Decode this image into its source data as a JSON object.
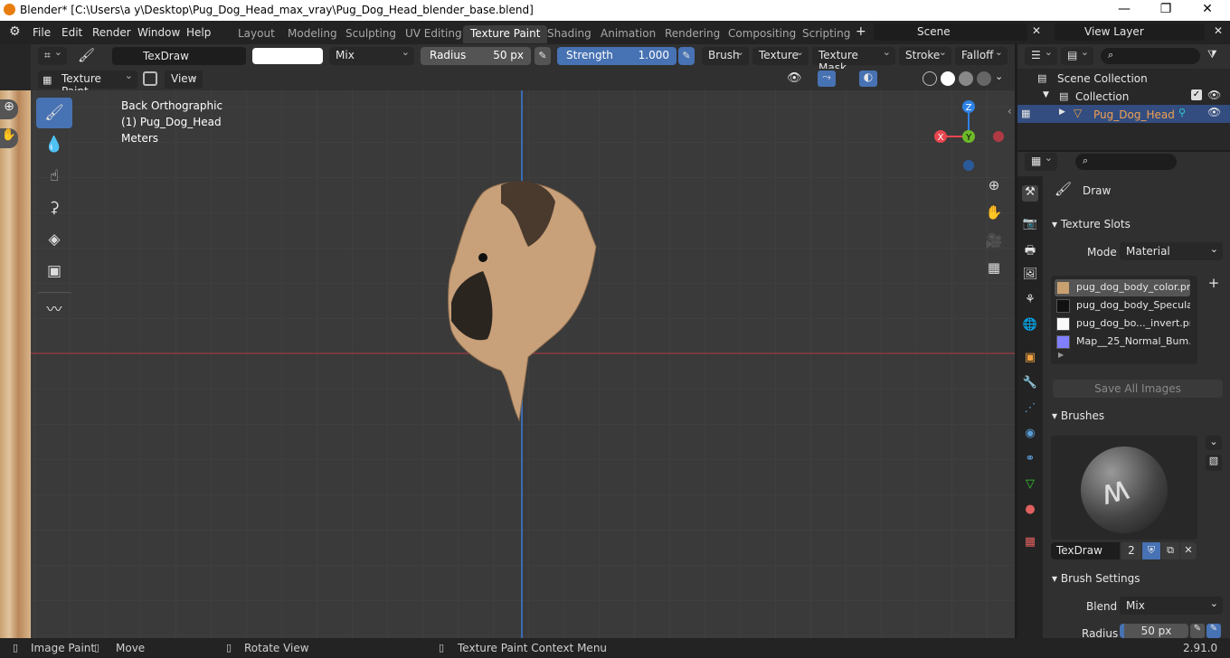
{
  "window": {
    "title": "Blender* [C:\\Users\\a y\\Desktop\\Pug_Dog_Head_max_vray\\Pug_Dog_Head_blender_base.blend]",
    "controls": [
      "—",
      "❐",
      "✕"
    ]
  },
  "menu": {
    "items": [
      "File",
      "Edit",
      "Render",
      "Window",
      "Help"
    ]
  },
  "workspaces": [
    "Layout",
    "Modeling",
    "Sculpting",
    "UV Editing",
    "Texture Paint",
    "Shading",
    "Animation",
    "Rendering",
    "Compositing",
    "Scripting"
  ],
  "scene": {
    "label": "Scene",
    "view_layer": "View Layer"
  },
  "tool_header": {
    "brush_name": "TexDraw",
    "blend": "Mix",
    "radius_label": "Radius",
    "radius_value": "50 px",
    "strength_label": "Strength",
    "strength_value": "1.000",
    "menus": [
      "Brush",
      "Texture",
      "Texture Mask",
      "Stroke",
      "Falloff"
    ]
  },
  "viewport_header": {
    "mode": "Texture Paint",
    "view": "View"
  },
  "viewport": {
    "line1": "Back Orthographic",
    "line2": "(1) Pug_Dog_Head",
    "line3": "Meters",
    "axes": {
      "x": "X",
      "y": "Y",
      "z": "Z"
    }
  },
  "outliner": {
    "scene_collection": "Scene Collection",
    "collection": "Collection",
    "object": "Pug_Dog_Head"
  },
  "properties": {
    "tool_name": "Draw",
    "texture_slots_title": "Texture Slots",
    "mode_label": "Mode",
    "mode_value": "Material",
    "slots": [
      "pug_dog_body_color.png",
      "pug_dog_body_Specula...",
      "pug_dog_bo..._invert.png",
      "Map__25_Normal_Bum..."
    ],
    "save_all": "Save All Images",
    "brushes_title": "Brushes",
    "brush_name": "TexDraw",
    "brush_users": "2",
    "brush_settings_title": "Brush Settings",
    "blend_label": "Blend",
    "blend_value": "Mix",
    "radius_label": "Radius",
    "radius_value": "50 px"
  },
  "status": {
    "image_paint": "Image Paint",
    "move": "Move",
    "rotate": "Rotate View",
    "context": "Texture Paint Context Menu",
    "version": "2.91.0"
  },
  "colors": {
    "accent": "#4772b3",
    "x_axis": "#e8464f",
    "y_axis": "#6eb92a",
    "z_axis": "#2e82e6"
  }
}
